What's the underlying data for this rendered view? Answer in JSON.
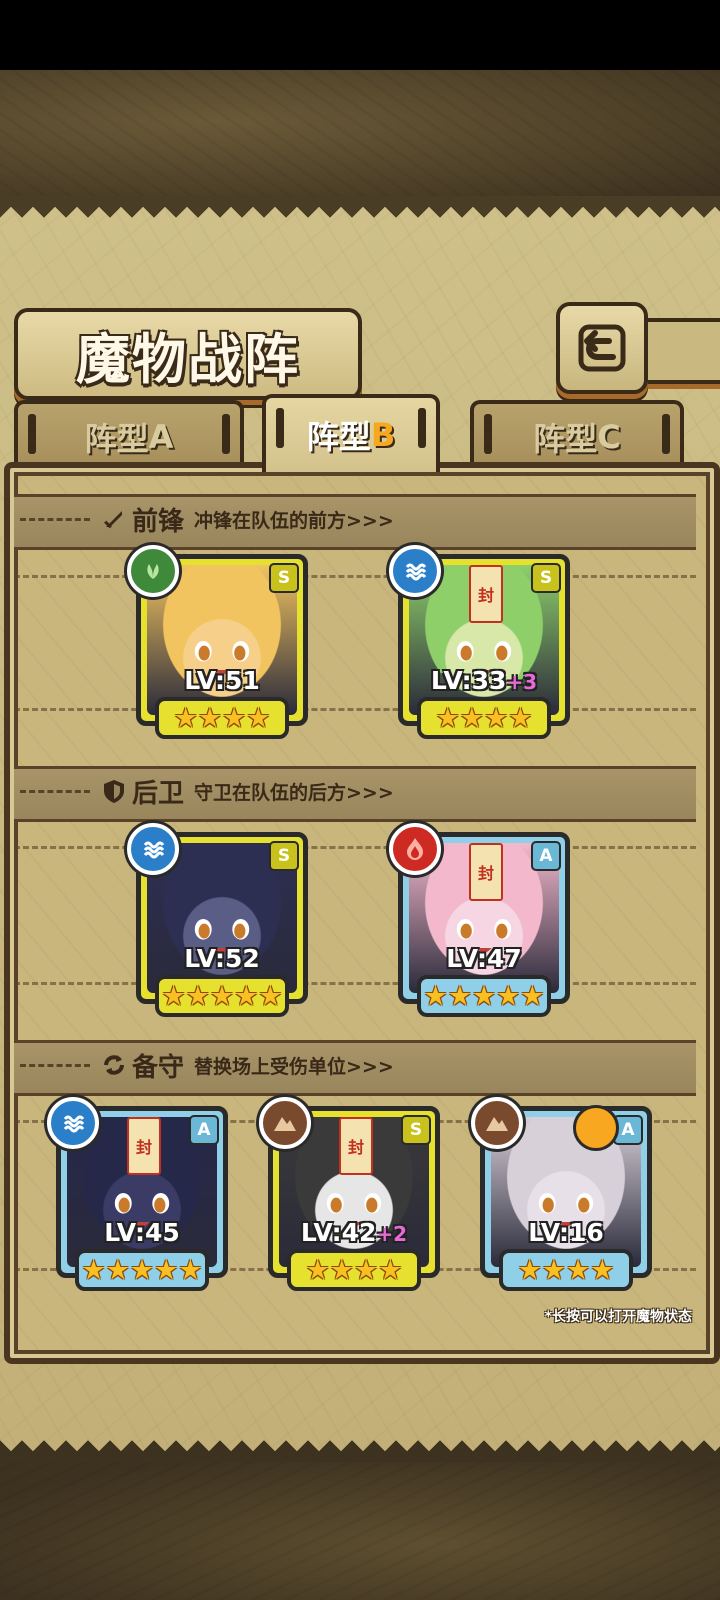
{
  "header": {
    "title": "魔物战阵"
  },
  "tabs": [
    {
      "prefix": "阵型",
      "letter": "A",
      "active": false
    },
    {
      "prefix": "阵型",
      "letter": "B",
      "active": true
    },
    {
      "prefix": "阵型",
      "letter": "C",
      "active": false
    }
  ],
  "sections": {
    "front": {
      "name": "前锋",
      "desc": "冲锋在队伍的前方>>>",
      "icon": "sword-icon"
    },
    "rear": {
      "name": "后卫",
      "desc": "守卫在队伍的后方>>>",
      "icon": "shield-icon"
    },
    "reserve": {
      "name": "备守",
      "desc": "替换场上受伤单位>>>",
      "icon": "swap-icon"
    }
  },
  "cards": {
    "c1": {
      "lv": "LV:51",
      "plus": "",
      "rank": "S",
      "stars": "★★★★",
      "element": "leaf-icon",
      "skin": "#f6d08a",
      "hair": "#f2c460"
    },
    "c2": {
      "lv": "LV:33",
      "plus": "+3",
      "rank": "S",
      "stars": "★★★★",
      "element": "water-icon",
      "skin": "#d7e8a8",
      "hair": "#8ecf6a"
    },
    "c3": {
      "lv": "LV:52",
      "plus": "",
      "rank": "S",
      "stars": "★★★★★",
      "element": "water-icon",
      "skin": "#5a5e86",
      "hair": "#2c2f52"
    },
    "c4": {
      "lv": "LV:47",
      "plus": "",
      "rank": "A",
      "stars": "★★★★★",
      "element": "fire-icon",
      "skin": "#f6d6e2",
      "hair": "#f4b8cc"
    },
    "c5": {
      "lv": "LV:45",
      "plus": "",
      "rank": "A",
      "stars": "★★★★★",
      "element": "water-icon",
      "skin": "#3a3c66",
      "hair": "#26284a"
    },
    "c6": {
      "lv": "LV:42",
      "plus": "+2",
      "rank": "S",
      "stars": "★★★★",
      "element": "earth-icon",
      "skin": "#e6e6e6",
      "hair": "#3a3a3a"
    },
    "c7": {
      "lv": "LV:16",
      "plus": "",
      "rank": "A",
      "stars": "★★★★",
      "element": "earth-icon",
      "skin": "#e8e0e8",
      "hair": "#d8d0d8"
    }
  },
  "talisman_char": "封",
  "hint": "*长按可以打开魔物状态"
}
